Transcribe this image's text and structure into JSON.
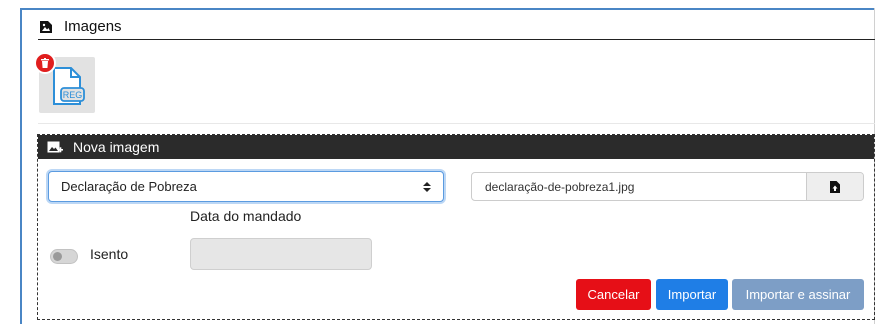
{
  "imagens_section": {
    "title": "Imagens",
    "icon": "image-file-icon",
    "attachment": {
      "icon": "reg-file-icon",
      "file_label": "REG",
      "delete_icon": "trash-icon"
    }
  },
  "nova_imagem_panel": {
    "title": "Nova imagem",
    "icon": "add-image-icon",
    "document_type_select": {
      "selected": "Declaração de Pobreza"
    },
    "file_input": {
      "file_name": "declaração-de-pobreza1.jpg",
      "button_icon": "upload-file-icon"
    },
    "date_field": {
      "label": "Data do mandado",
      "value": ""
    },
    "exempt_toggle": {
      "label": "Isento",
      "checked": false
    },
    "buttons": {
      "cancel": "Cancelar",
      "import": "Importar",
      "import_and_sign": "Importar e assinar"
    }
  },
  "colors": {
    "accent_blue": "#1f7ee6",
    "danger_red": "#e60f17",
    "disabled_blue": "#7d9ec6",
    "panel_header": "#2b2b2b",
    "frame_blue": "#4a86c5"
  }
}
